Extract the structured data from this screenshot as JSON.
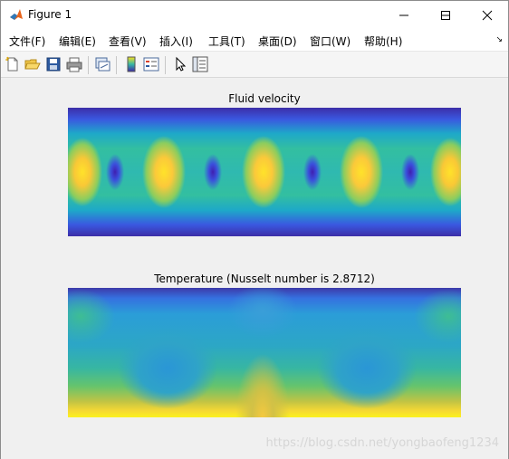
{
  "window": {
    "title": "Figure 1",
    "controls": {
      "minimize_icon": "minimize-icon",
      "maximize_icon": "maximize-icon",
      "close_icon": "close-icon"
    }
  },
  "menubar": {
    "items": [
      {
        "label": "文件(F)"
      },
      {
        "label": "编辑(E)"
      },
      {
        "label": "查看(V)"
      },
      {
        "label": "插入(I)"
      },
      {
        "label": "工具(T)"
      },
      {
        "label": "桌面(D)"
      },
      {
        "label": "窗口(W)"
      },
      {
        "label": "帮助(H)"
      }
    ],
    "overflow_icon": "chevron-icon"
  },
  "toolbar": {
    "buttons": [
      {
        "icon": "new-figure-icon"
      },
      {
        "icon": "open-file-icon"
      },
      {
        "icon": "save-icon"
      },
      {
        "icon": "print-icon"
      },
      {
        "icon": "link-plot-icon"
      },
      {
        "icon": "insert-colorbar-icon"
      },
      {
        "icon": "insert-legend-icon"
      },
      {
        "icon": "pointer-icon"
      },
      {
        "icon": "property-inspector-icon"
      }
    ]
  },
  "plots": {
    "velocity": {
      "title": "Fluid velocity",
      "colormap": "parula"
    },
    "temperature": {
      "title": "Temperature (Nusselt number is 2.8712)",
      "colormap": "parula"
    }
  },
  "watermark": "https://blog.csdn.net/yongbaofeng1234",
  "colors": {
    "figure_background": "#f0f0f0",
    "parula_low": "#3e26a8",
    "parula_high": "#f9fb15"
  }
}
